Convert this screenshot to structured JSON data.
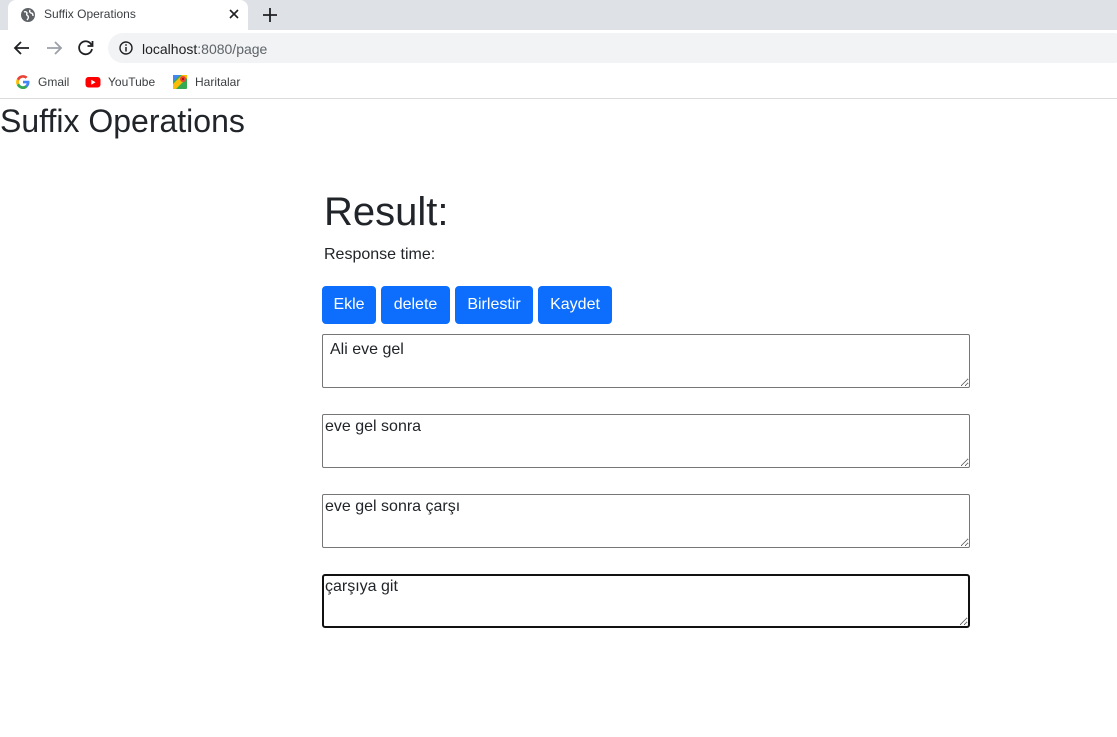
{
  "browser": {
    "tab_title": "Suffix Operations",
    "url_host": "localhost",
    "url_rest": ":8080/page",
    "bookmarks": [
      {
        "label": "Gmail",
        "icon": "google-icon"
      },
      {
        "label": "YouTube",
        "icon": "youtube-icon"
      },
      {
        "label": "Haritalar",
        "icon": "maps-icon"
      }
    ]
  },
  "page": {
    "title": "Suffix Operations",
    "result_heading": "Result:",
    "response_time_label": "Response time:",
    "buttons": {
      "add": "Ekle",
      "delete": "delete",
      "merge": "Birlestir",
      "save": "Kaydet"
    },
    "textareas": [
      "Ali eve gel",
      "eve gel sonra",
      "eve gel sonra çarşı",
      "çarşıya git"
    ]
  },
  "colors": {
    "primary": "#0d6efd",
    "tabstrip": "#dee1e6",
    "omnibox": "#f1f3f4"
  }
}
